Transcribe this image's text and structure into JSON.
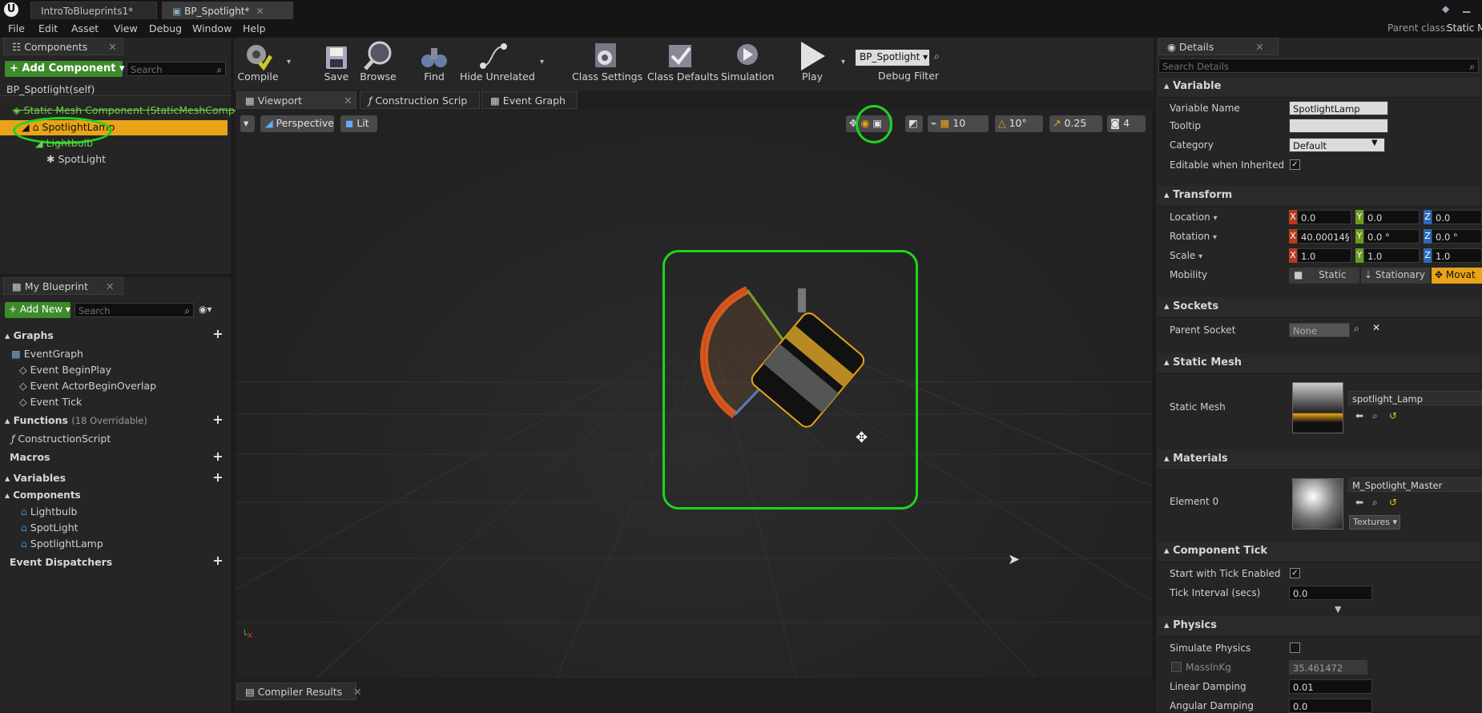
{
  "tabs": {
    "doc1": "IntroToBlueprints1*",
    "doc2": "BP_Spotlight*"
  },
  "parent_class": {
    "label": "Parent class:",
    "value": "Static M"
  },
  "menu": [
    "File",
    "Edit",
    "Asset",
    "View",
    "Debug",
    "Window",
    "Help"
  ],
  "components": {
    "tab": "Components",
    "add_button": "+ Add Component ▾",
    "search_placeholder": "Search",
    "self_label": "BP_Spotlight(self)",
    "tree": [
      "Static Mesh Component (StaticMeshCompon",
      "SpotlightLamp",
      "Lightbulb",
      "SpotLight"
    ]
  },
  "my_blueprint": {
    "tab": "My Blueprint",
    "add_new": "+ Add New ▾",
    "search_placeholder": "Search",
    "graphs_head": "Graphs",
    "graphs": [
      "EventGraph",
      "Event BeginPlay",
      "Event ActorBeginOverlap",
      "Event Tick"
    ],
    "functions_head": "Functions",
    "functions_count": "(18 Overridable)",
    "functions": [
      "ConstructionScript"
    ],
    "macros_head": "Macros",
    "variables_head": "Variables",
    "components_head": "Components",
    "components": [
      "Lightbulb",
      "SpotLight",
      "SpotlightLamp"
    ],
    "dispatchers_head": "Event Dispatchers"
  },
  "toolbar": {
    "compile": "Compile",
    "save": "Save",
    "browse": "Browse",
    "find": "Find",
    "hide_unrelated": "Hide Unrelated",
    "class_settings": "Class Settings",
    "class_defaults": "Class Defaults",
    "simulation": "Simulation",
    "play": "Play",
    "debug_select": "BP_Spotlight ▾",
    "debug_filter": "Debug Filter"
  },
  "editor_tabs": [
    "Viewport",
    "Construction Scrip",
    "Event Graph"
  ],
  "viewport": {
    "perspective": "Perspective",
    "lit": "Lit",
    "grid": "10",
    "angle": "10°",
    "scale": "0.25",
    "speed": "4"
  },
  "compiler_tab": "Compiler Results",
  "details": {
    "tab": "Details",
    "search_placeholder": "Search Details",
    "variable_head": "Variable",
    "variable_name_label": "Variable Name",
    "variable_name": "SpotlightLamp",
    "tooltip_label": "Tooltip",
    "tooltip": "",
    "category_label": "Category",
    "category": "Default",
    "editable_label": "Editable when Inherited",
    "transform_head": "Transform",
    "location_label": "Location",
    "location": [
      "0.0",
      "0.0",
      "0.0"
    ],
    "rotation_label": "Rotation",
    "rotation": [
      "40.00014§",
      "0.0 °",
      "0.0 °"
    ],
    "scale_label": "Scale",
    "scale": [
      "1.0",
      "1.0",
      "1.0"
    ],
    "mobility_label": "Mobility",
    "mobility": [
      "Static",
      "Stationary",
      "Movat"
    ],
    "sockets_head": "Sockets",
    "parent_socket_label": "Parent Socket",
    "parent_socket": "None",
    "static_mesh_head": "Static Mesh",
    "static_mesh_label": "Static Mesh",
    "static_mesh": "spotlight_Lamp",
    "materials_head": "Materials",
    "element0_label": "Element 0",
    "element0": "M_Spotlight_Master",
    "textures": "Textures ▾",
    "tick_head": "Component Tick",
    "tick_enabled_label": "Start with Tick Enabled",
    "tick_interval_label": "Tick Interval (secs)",
    "tick_interval": "0.0",
    "physics_head": "Physics",
    "simulate_label": "Simulate Physics",
    "mass_label": "MassInKg",
    "mass": "35.461472",
    "linear_label": "Linear Damping",
    "linear": "0.01",
    "angular_label": "Angular Damping",
    "angular": "0.0"
  }
}
